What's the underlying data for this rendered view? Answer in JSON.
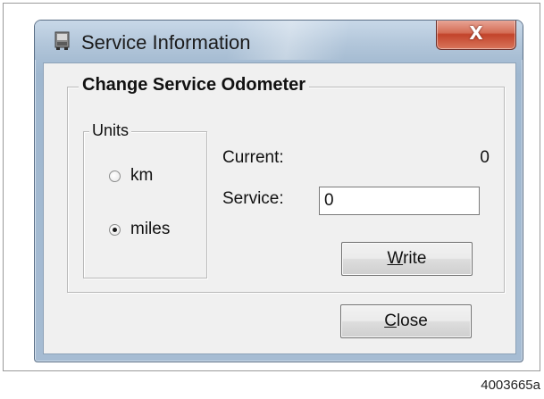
{
  "window": {
    "title": "Service Information",
    "close_glyph": "X"
  },
  "odometer_group": {
    "legend": "Change Service Odometer"
  },
  "units_group": {
    "legend": "Units",
    "options": [
      {
        "label": "km",
        "checked": false
      },
      {
        "label": "miles",
        "checked": true
      }
    ]
  },
  "fields": {
    "current_label": "Current:",
    "current_value": "0",
    "service_label": "Service:",
    "service_value": "0"
  },
  "buttons": {
    "write": {
      "mnemonic": "W",
      "rest": "rite"
    },
    "close": {
      "mnemonic": "C",
      "rest": "lose"
    }
  },
  "figure_code": "4003665a",
  "colors": {
    "title_bar": "#b2c6da",
    "close_button": "#c2432a",
    "dialog_face": "#f0f0f0"
  }
}
